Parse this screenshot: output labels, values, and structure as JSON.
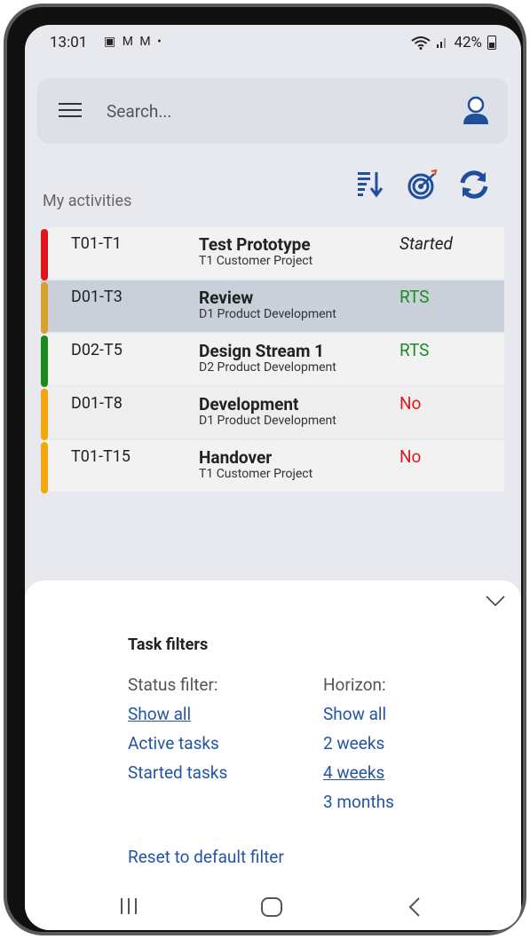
{
  "status_bar": {
    "time": "13:01",
    "left_icons": "▣ M M •",
    "battery": "42%"
  },
  "search": {
    "placeholder": "Search..."
  },
  "section_title": "My activities",
  "activities": [
    {
      "id": "T01-T1",
      "title": "Test Prototype",
      "project": "T1 Customer Project",
      "status": "Started",
      "status_color": "#222222",
      "bar_color": "#e0141b",
      "italic": true
    },
    {
      "id": "D01-T3",
      "title": "Review",
      "project": "D1 Product Development",
      "status": "RTS",
      "status_color": "#1e8a24",
      "bar_color": "#d9a030",
      "italic": false
    },
    {
      "id": "D02-T5",
      "title": "Design Stream 1",
      "project": "D2  Product Development",
      "status": "RTS",
      "status_color": "#1e8a24",
      "bar_color": "#1a8a1a",
      "italic": false
    },
    {
      "id": "D01-T8",
      "title": "Development",
      "project": "D1 Product Development",
      "status": "No",
      "status_color": "#e01818",
      "bar_color": "#f4a610",
      "italic": false
    },
    {
      "id": "T01-T15",
      "title": "Handover",
      "project": "T1 Customer Project",
      "status": "No",
      "status_color": "#e01818",
      "bar_color": "#f4a610",
      "italic": false
    }
  ],
  "filters": {
    "title": "Task filters",
    "status_header": "Status filter:",
    "status_options": [
      "Show all",
      "Active tasks",
      "Started tasks"
    ],
    "horizon_header": "Horizon:",
    "horizon_options": [
      "Show all",
      "2 weeks",
      "4 weeks",
      "3 months"
    ],
    "reset_label": "Reset to default filter"
  },
  "colors": {
    "link": "#2455a4",
    "toolbar_icon": "#1f4e9c"
  }
}
